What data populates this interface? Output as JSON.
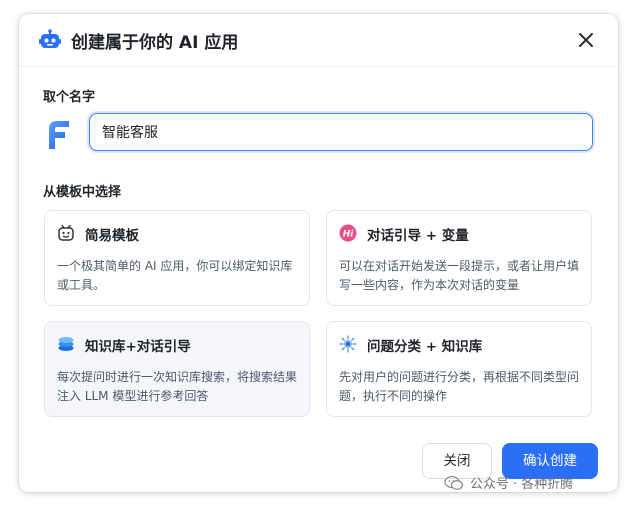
{
  "dialog": {
    "title": "创建属于你的 AI 应用",
    "name_section_label": "取个名字",
    "name_input_value": "智能客服",
    "template_section_label": "从模板中选择",
    "templates": [
      {
        "icon": "robot-face-icon",
        "title": "简易模板",
        "description": "一个极其简单的 AI 应用，你可以绑定知识库或工具。"
      },
      {
        "icon": "hi-chat-icon",
        "title": "对话引导 + 变量",
        "description": "可以在对话开始发送一段提示，或者让用户填写一些内容，作为本次对话的变量"
      },
      {
        "icon": "database-stack-icon",
        "title": "知识库+对话引导",
        "description": "每次提问时进行一次知识库搜索，将搜索结果注入 LLM 模型进行参考回答"
      },
      {
        "icon": "sparkle-network-icon",
        "title": "问题分类 + 知识库",
        "description": "先对用户的问题进行分类，再根据不同类型问题，执行不同的操作"
      }
    ],
    "cancel_label": "关闭",
    "confirm_label": "确认创建",
    "accent_color": "#2b6ff6"
  },
  "watermark": {
    "platform": "公众号",
    "separator": "·",
    "author": "各种折腾"
  }
}
